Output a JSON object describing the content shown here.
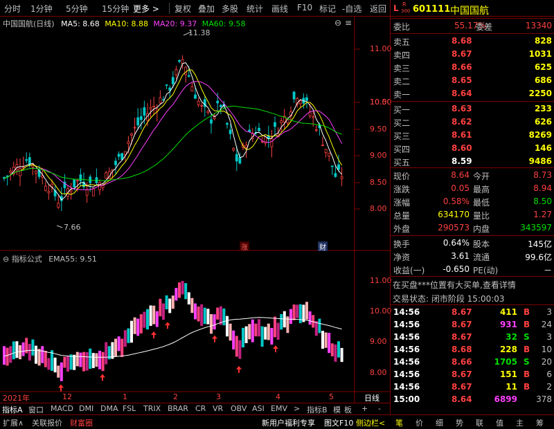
{
  "toolbar": {
    "items": [
      "分时",
      "1分钟",
      "5分钟",
      "15分钟",
      "更多 >",
      "复权",
      "叠加",
      "多股",
      "统计",
      "画线",
      "F10",
      "标记",
      "-自选",
      "返回"
    ]
  },
  "quote_header": {
    "market_badge": "L",
    "sub_badge": "R",
    "badge_num": "300",
    "code": "601111",
    "name": "中国国航"
  },
  "kline": {
    "title": "中国国航(日线)",
    "ma5": "MA5: 8.68",
    "ma10": "MA10: 8.88",
    "ma20": "MA20: 9.37",
    "ma60": "MA60: 9.58",
    "high_label": "11.38",
    "low_label": "7.66",
    "price_ticks": [
      "11.00",
      "10.50",
      "10.00",
      "9.50",
      "9.00",
      "8.50",
      "8.00"
    ],
    "marker_zhang": "涨",
    "marker_cai": "财"
  },
  "indicator": {
    "title": "指标公式",
    "ema": "EMA55: 9.51",
    "ticks": [
      "11.00",
      "10.00",
      "9.00",
      "8.00"
    ]
  },
  "time_axis": {
    "labels": [
      "2021年",
      "12",
      "1",
      "2",
      "3",
      "4",
      "5"
    ],
    "period": "日线"
  },
  "tabs_row1": [
    "指标A",
    "窗口",
    "MACD",
    "DMI",
    "DMA",
    "FSL",
    "TRIX",
    "BRAR",
    "CR",
    "VR",
    "OBV",
    "ASI",
    "EMV",
    ">",
    "指标B",
    "模",
    "板",
    "+",
    "-"
  ],
  "tabs_row2": [
    "扩展∧",
    "关联报价",
    "财富圈",
    "新用户福利专享",
    "图文F10",
    "侧边栏<"
  ],
  "right_tabs": [
    "笔",
    "价",
    "细",
    "势",
    "联",
    "值",
    "主",
    "筹"
  ],
  "order_book": {
    "weibi_label": "委比",
    "weibi": "55.17%",
    "weicha_label": "委差",
    "weicha": "13340",
    "asks": [
      {
        "label": "卖五",
        "price": "8.68",
        "vol": "828"
      },
      {
        "label": "卖四",
        "price": "8.67",
        "vol": "1031"
      },
      {
        "label": "卖三",
        "price": "8.66",
        "vol": "625"
      },
      {
        "label": "卖二",
        "price": "8.65",
        "vol": "686"
      },
      {
        "label": "卖一",
        "price": "8.64",
        "vol": "2250"
      }
    ],
    "bids": [
      {
        "label": "买一",
        "price": "8.63",
        "vol": "233"
      },
      {
        "label": "买二",
        "price": "8.62",
        "vol": "626"
      },
      {
        "label": "买三",
        "price": "8.61",
        "vol": "8269"
      },
      {
        "label": "买四",
        "price": "8.60",
        "vol": "146"
      },
      {
        "label": "买五",
        "price": "8.59",
        "vol": "9486"
      }
    ]
  },
  "stats": [
    {
      "l1": "现价",
      "v1": "8.64",
      "l2": "今开",
      "v2": "8.73"
    },
    {
      "l1": "涨跌",
      "v1": "0.05",
      "l2": "最高",
      "v2": "8.94"
    },
    {
      "l1": "涨幅",
      "v1": "0.58%",
      "l2": "最低",
      "v2": "8.50"
    },
    {
      "l1": "总量",
      "v1": "634170",
      "l2": "量比",
      "v2": "1.27"
    },
    {
      "l1": "外盘",
      "v1": "290573",
      "l2": "内盘",
      "v2": "343597"
    }
  ],
  "stats2": [
    {
      "l1": "换手",
      "v1": "0.64%",
      "l2": "股本",
      "v2": "145亿"
    },
    {
      "l1": "净资",
      "v1": "3.61",
      "l2": "流通",
      "v2": "99.6亿"
    },
    {
      "l1": "收益(一)",
      "v1": "-0.650",
      "l2": "PE(动)",
      "v2": "－"
    }
  ],
  "notice": "在买盘***位置有大买单,查看详情",
  "trade_status": "交易状态: 闭市阶段 15:00:03",
  "ticks": [
    {
      "time": "14:56",
      "price": "8.67",
      "vol": "411",
      "side": "B",
      "n": "3"
    },
    {
      "time": "14:56",
      "price": "8.67",
      "vol": "931",
      "side": "B",
      "n": "24"
    },
    {
      "time": "14:56",
      "price": "8.67",
      "vol": "32",
      "side": "S",
      "n": "3"
    },
    {
      "time": "14:56",
      "price": "8.68",
      "vol": "228",
      "side": "B",
      "n": "10"
    },
    {
      "time": "14:56",
      "price": "8.66",
      "vol": "1705",
      "side": "S",
      "n": "20"
    },
    {
      "time": "14:56",
      "price": "8.67",
      "vol": "151",
      "side": "B",
      "n": "6"
    },
    {
      "time": "14:56",
      "price": "8.67",
      "vol": "11",
      "side": "B",
      "n": "2"
    },
    {
      "time": "15:00",
      "price": "8.64",
      "vol": "6899",
      "side": "",
      "n": "378"
    }
  ],
  "colors": {
    "up": "#ff4040",
    "down": "#00e000",
    "ma5": "#ffffff",
    "ma10": "#ffff00",
    "ma20": "#ff40ff",
    "ma60": "#00e000",
    "frame": "#800000"
  }
}
